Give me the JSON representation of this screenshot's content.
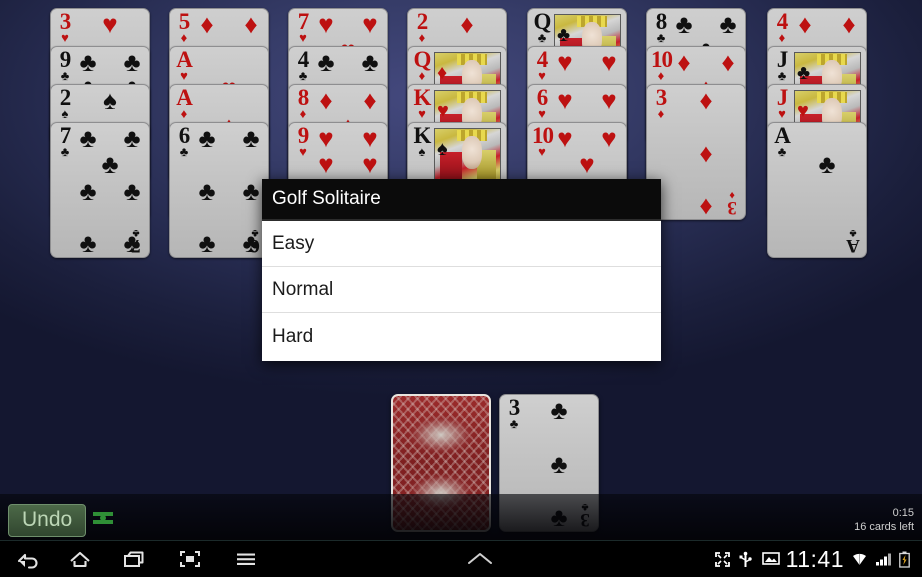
{
  "app": {
    "title": "Golf Solitaire"
  },
  "dialog": {
    "title": "Golf Solitaire",
    "options": [
      {
        "label": "Easy"
      },
      {
        "label": "Normal"
      },
      {
        "label": "Hard"
      }
    ]
  },
  "hud": {
    "undo_label": "Undo",
    "redo_icon": "redo-icon",
    "timer": "0:15",
    "cards_left": "16 cards left"
  },
  "tableau": {
    "columns": [
      {
        "cards": [
          {
            "rank": "3",
            "suit": "♥",
            "color": "red",
            "pips": 3,
            "face": false
          },
          {
            "rank": "9",
            "suit": "♣",
            "color": "black",
            "pips": 9,
            "face": false
          },
          {
            "rank": "2",
            "suit": "♠",
            "color": "black",
            "pips": 2,
            "face": false
          },
          {
            "rank": "7",
            "suit": "♣",
            "color": "black",
            "pips": 7,
            "face": false
          }
        ]
      },
      {
        "cards": [
          {
            "rank": "5",
            "suit": "♦",
            "color": "red",
            "pips": 5,
            "face": false
          },
          {
            "rank": "A",
            "suit": "♥",
            "color": "red",
            "pips": 1,
            "face": false
          },
          {
            "rank": "A",
            "suit": "♦",
            "color": "red",
            "pips": 1,
            "face": false
          },
          {
            "rank": "6",
            "suit": "♣",
            "color": "black",
            "pips": 6,
            "face": false
          }
        ]
      },
      {
        "cards": [
          {
            "rank": "7",
            "suit": "♥",
            "color": "red",
            "pips": 7,
            "face": false
          },
          {
            "rank": "4",
            "suit": "♣",
            "color": "black",
            "pips": 4,
            "face": false
          },
          {
            "rank": "8",
            "suit": "♦",
            "color": "red",
            "pips": 8,
            "face": false
          },
          {
            "rank": "9",
            "suit": "♥",
            "color": "red",
            "pips": 9,
            "face": false
          }
        ]
      },
      {
        "cards": [
          {
            "rank": "2",
            "suit": "♦",
            "color": "red",
            "pips": 2,
            "face": false
          },
          {
            "rank": "Q",
            "suit": "♦",
            "color": "red",
            "pips": 0,
            "face": true
          },
          {
            "rank": "K",
            "suit": "♥",
            "color": "red",
            "pips": 0,
            "face": true
          },
          {
            "rank": "K",
            "suit": "♠",
            "color": "black",
            "pips": 0,
            "face": true
          }
        ]
      },
      {
        "cards": [
          {
            "rank": "Q",
            "suit": "♣",
            "color": "black",
            "pips": 0,
            "face": true
          },
          {
            "rank": "4",
            "suit": "♥",
            "color": "red",
            "pips": 4,
            "face": false
          },
          {
            "rank": "6",
            "suit": "♥",
            "color": "red",
            "pips": 6,
            "face": false
          },
          {
            "rank": "10",
            "suit": "♥",
            "color": "red",
            "pips": 10,
            "face": false
          }
        ]
      },
      {
        "cards": [
          {
            "rank": "8",
            "suit": "♣",
            "color": "black",
            "pips": 8,
            "face": false
          },
          {
            "rank": "10",
            "suit": "♦",
            "color": "red",
            "pips": 10,
            "face": false
          },
          {
            "rank": "3",
            "suit": "♦",
            "color": "red",
            "pips": 3,
            "face": false
          }
        ]
      },
      {
        "cards": [
          {
            "rank": "4",
            "suit": "♦",
            "color": "red",
            "pips": 4,
            "face": false
          },
          {
            "rank": "J",
            "suit": "♣",
            "color": "black",
            "pips": 0,
            "face": true
          },
          {
            "rank": "J",
            "suit": "♥",
            "color": "red",
            "pips": 0,
            "face": true
          },
          {
            "rank": "A",
            "suit": "♣",
            "color": "black",
            "pips": 1,
            "face": false
          }
        ]
      }
    ]
  },
  "piles": {
    "stock": {
      "face_down": true,
      "name": "stock-pile"
    },
    "waste": {
      "rank": "3",
      "suit": "♣",
      "color": "black",
      "pips": 3
    }
  },
  "nav_bar": {
    "items": [
      {
        "name": "back-icon"
      },
      {
        "name": "home-icon"
      },
      {
        "name": "recents-icon"
      },
      {
        "name": "screenshot-icon"
      },
      {
        "name": "menu-icon"
      },
      {
        "name": "chevron-up-icon"
      }
    ],
    "tray": {
      "expand_icon": "expand-icon",
      "usb_icon": "usb-icon",
      "image_icon": "image-icon",
      "clock": "11:41",
      "wifi_icon": "wifi-icon",
      "signal_icon": "signal-icon",
      "battery_icon": "battery-icon"
    }
  },
  "colors": {
    "red_suit": "#bd1111",
    "black_suit": "#101010",
    "card_face": "#c6c6c6",
    "background_top": "#3a3f6e",
    "background_bottom": "#0a0b18",
    "dialog_title_bg": "#0b0b0b",
    "undo_green": "#4c6948"
  }
}
